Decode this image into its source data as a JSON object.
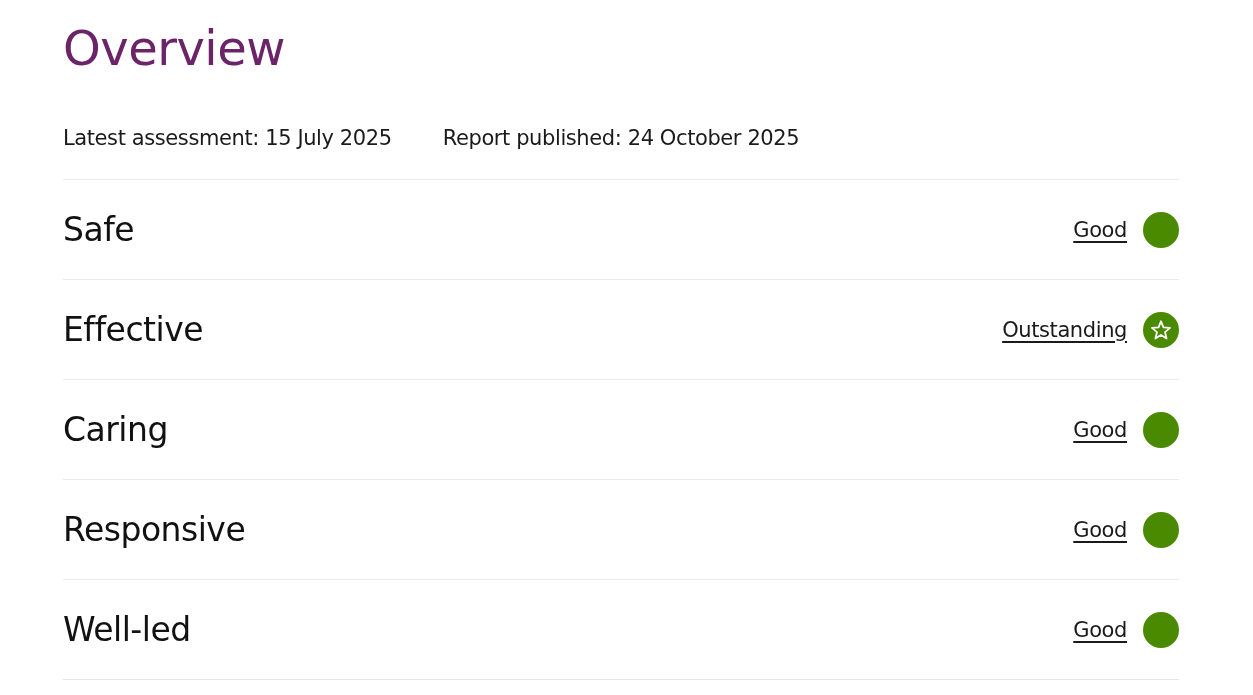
{
  "title": "Overview",
  "meta": [
    "Latest assessment: 15 July 2025",
    "Report published: 24 October 2025"
  ],
  "ratings": [
    {
      "name": "Safe",
      "rating": "Good",
      "kind": "good"
    },
    {
      "name": "Effective",
      "rating": "Outstanding",
      "kind": "outstanding"
    },
    {
      "name": "Caring",
      "rating": "Good",
      "kind": "good"
    },
    {
      "name": "Responsive",
      "rating": "Good",
      "kind": "good"
    },
    {
      "name": "Well-led",
      "rating": "Good",
      "kind": "good"
    }
  ]
}
